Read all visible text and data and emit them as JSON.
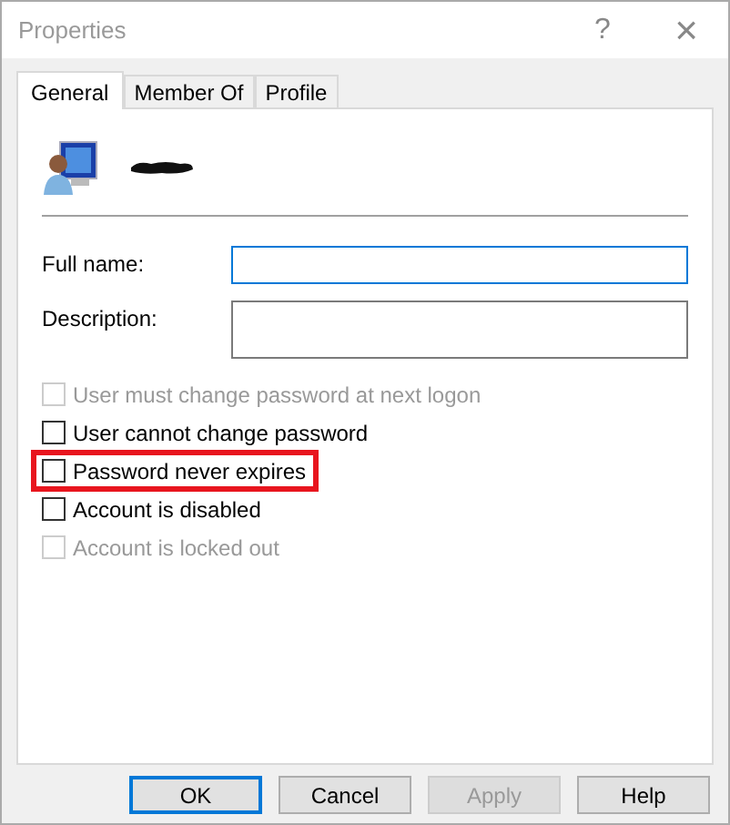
{
  "window": {
    "title": "Properties",
    "help": "?",
    "close": "×"
  },
  "tabs": [
    {
      "label": "General",
      "selected": true
    },
    {
      "label": "Member Of",
      "selected": false
    },
    {
      "label": "Profile",
      "selected": false
    }
  ],
  "user": {
    "name_redacted": true
  },
  "fields": [
    {
      "label": "Full name:",
      "kind": "line",
      "focused": true
    },
    {
      "label": "Description:",
      "kind": "box",
      "focused": false
    }
  ],
  "checkboxes": [
    {
      "label": "User must change password at next logon",
      "checked": false,
      "disabled": true,
      "highlighted": false
    },
    {
      "label": "User cannot change password",
      "checked": false,
      "disabled": false,
      "highlighted": false
    },
    {
      "label": "Password never expires",
      "checked": false,
      "disabled": false,
      "highlighted": true
    },
    {
      "label": "Account is disabled",
      "checked": false,
      "disabled": false,
      "highlighted": false
    },
    {
      "label": "Account is locked out",
      "checked": false,
      "disabled": true,
      "highlighted": false
    }
  ],
  "buttons": [
    {
      "label": "OK",
      "default": true,
      "disabled": false
    },
    {
      "label": "Cancel",
      "default": false,
      "disabled": false
    },
    {
      "label": "Apply",
      "default": false,
      "disabled": true
    },
    {
      "label": "Help",
      "default": false,
      "disabled": false
    }
  ]
}
